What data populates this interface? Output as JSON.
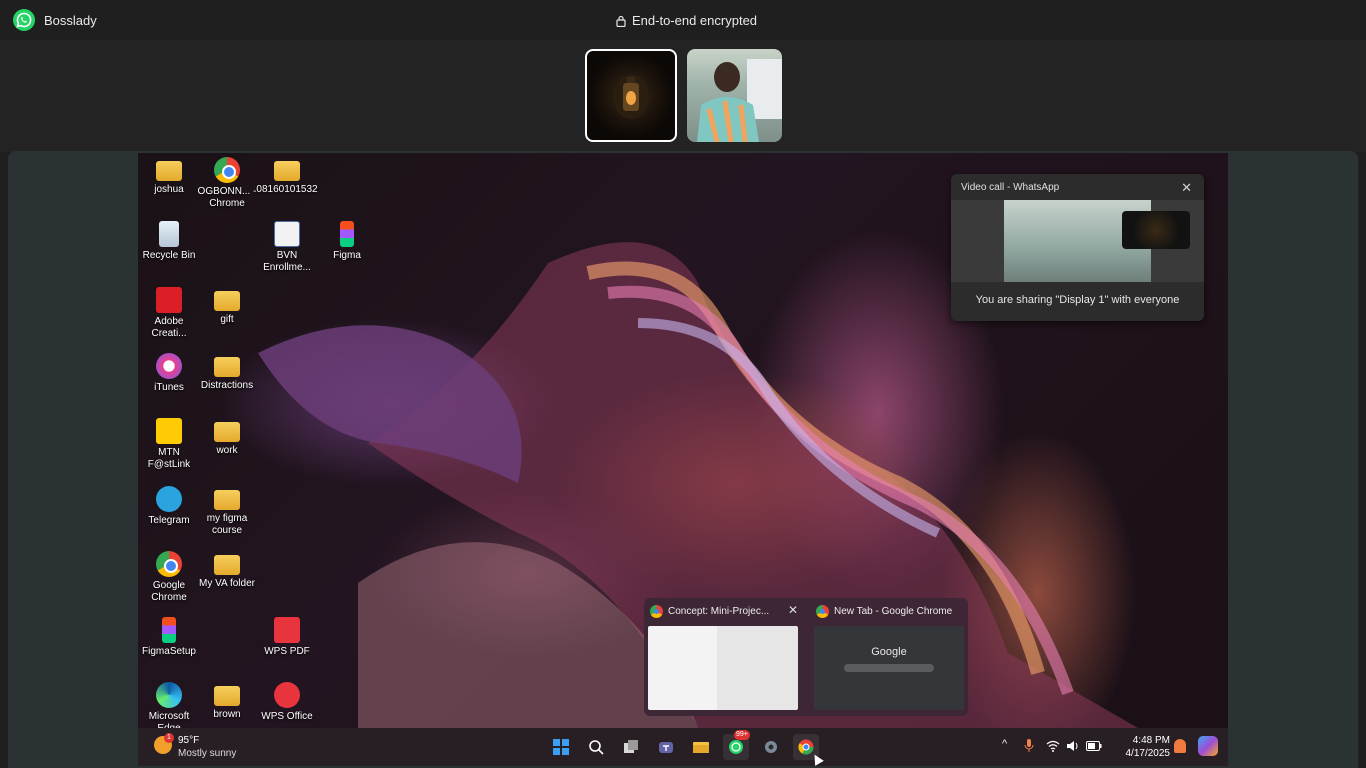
{
  "window": {
    "contact_name": "Bosslady",
    "encryption_label": "End-to-end encrypted"
  },
  "participants": [
    {
      "name": "lantern-avatar"
    },
    {
      "name": "camera-participant"
    }
  ],
  "desktop": {
    "icons": [
      {
        "label": "joshua",
        "icon": "folder-icon"
      },
      {
        "label": "OGBONN... - Chrome",
        "icon": "chrome-icon"
      },
      {
        "label": "08160101532",
        "icon": "folder-icon"
      },
      {
        "label": "Recycle Bin",
        "icon": "recycle-bin-icon"
      },
      {
        "label": "BVN Enrollme...",
        "icon": "bvn-app-icon"
      },
      {
        "label": "Figma",
        "icon": "figma-icon"
      },
      {
        "label": "Adobe Creati...",
        "icon": "adobe-icon"
      },
      {
        "label": "gift",
        "icon": "folder-icon"
      },
      {
        "label": "iTunes",
        "icon": "itunes-icon"
      },
      {
        "label": "Distractions",
        "icon": "folder-icon"
      },
      {
        "label": "MTN F@stLink",
        "icon": "mtn-icon"
      },
      {
        "label": "work",
        "icon": "folder-icon"
      },
      {
        "label": "Telegram",
        "icon": "telegram-icon"
      },
      {
        "label": "my figma course",
        "icon": "folder-icon"
      },
      {
        "label": "Google Chrome",
        "icon": "chrome-icon"
      },
      {
        "label": "My VA folder",
        "icon": "folder-icon"
      },
      {
        "label": "FigmaSetup",
        "icon": "figma-icon"
      },
      {
        "label": "WPS PDF",
        "icon": "wps-pdf-icon"
      },
      {
        "label": "Microsoft Edge",
        "icon": "edge-icon"
      },
      {
        "label": "brown",
        "icon": "folder-icon"
      },
      {
        "label": "WPS Office",
        "icon": "wps-office-icon"
      }
    ]
  },
  "share_popup": {
    "title": "Video call - WhatsApp",
    "close": "✕",
    "message": "You are sharing \"Display 1\" with everyone"
  },
  "chrome_previews": [
    {
      "title": "Concept: Mini-Projec...",
      "close": "✕"
    },
    {
      "title": "New Tab - Google Chrome",
      "logo": "Google"
    }
  ],
  "taskbar": {
    "weather": {
      "temp": "95°F",
      "condition": "Mostly sunny",
      "badge": "1"
    },
    "apps": [
      {
        "name": "start-icon"
      },
      {
        "name": "search-icon"
      },
      {
        "name": "task-view-icon"
      },
      {
        "name": "teams-icon"
      },
      {
        "name": "file-explorer-icon"
      },
      {
        "name": "whatsapp-icon",
        "badge": "99+"
      },
      {
        "name": "settings-icon"
      },
      {
        "name": "chrome-icon"
      }
    ],
    "tray": {
      "chevron": "^",
      "time": "4:48 PM",
      "date": "4/17/2025"
    }
  },
  "colors": {
    "whatsapp_green": "#25d366",
    "selected_tile_border": "#ffffff",
    "badge_red": "#dd3333"
  }
}
